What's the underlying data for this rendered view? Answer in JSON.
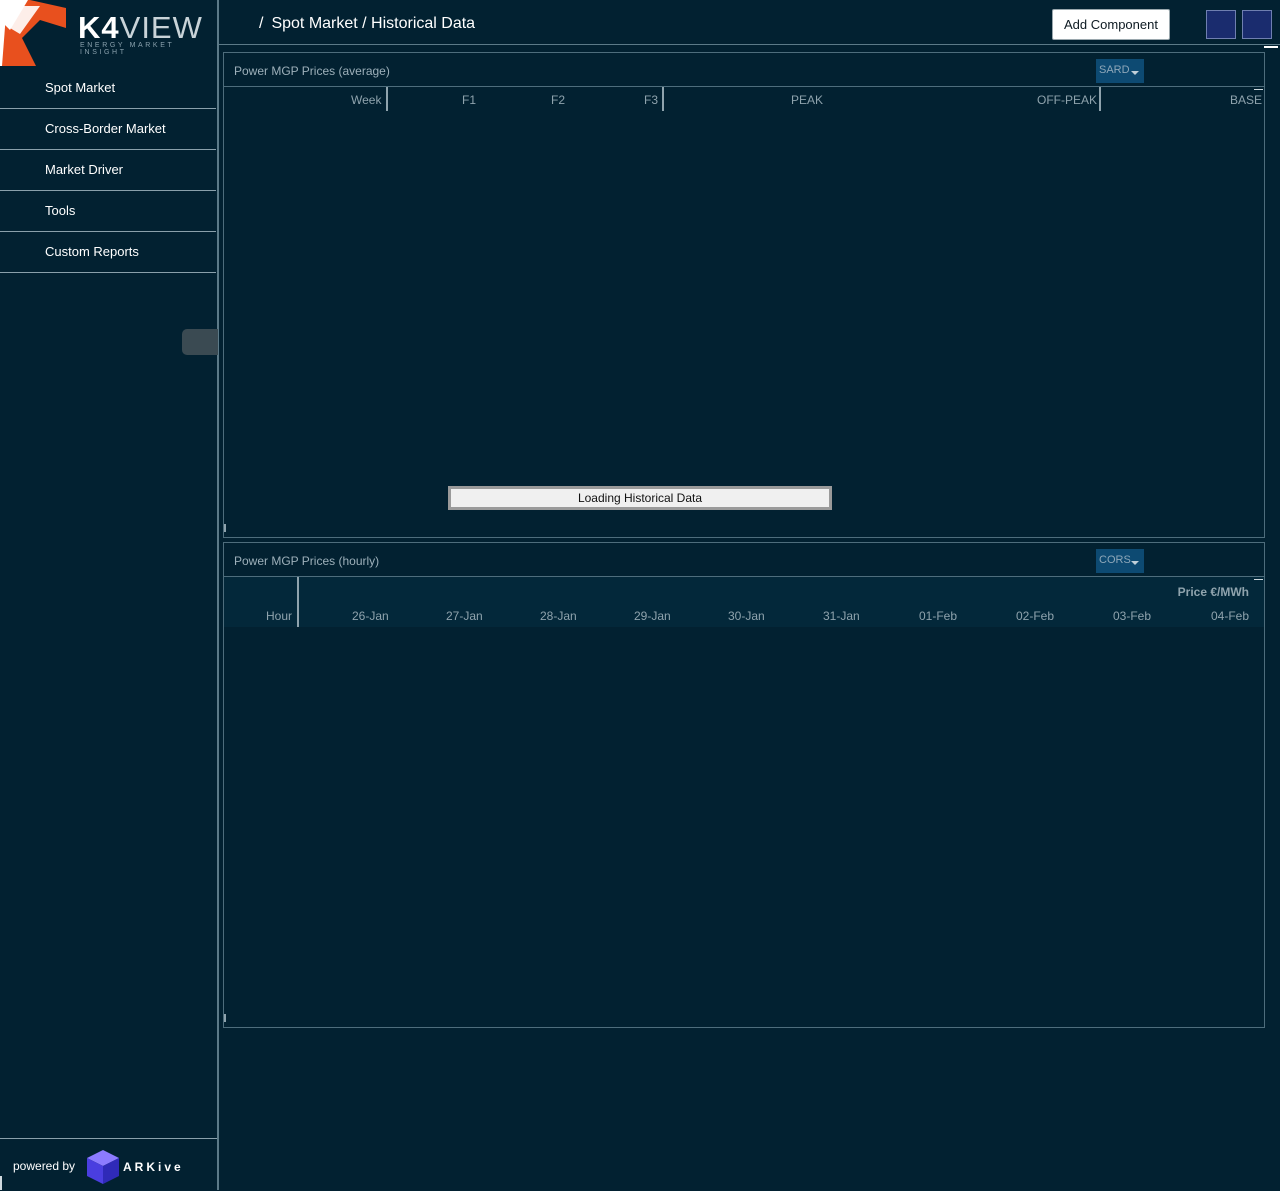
{
  "brand": {
    "logo_text_bold": "K4",
    "logo_text_light": "VIEW",
    "tagline": "ENERGY MARKET INSIGHT",
    "powered_by": "powered by",
    "partner": "ARKive"
  },
  "sidebar": {
    "items": [
      {
        "label": "Spot Market"
      },
      {
        "label": "Cross-Border Market"
      },
      {
        "label": "Market Driver"
      },
      {
        "label": "Tools"
      },
      {
        "label": "Custom Reports"
      }
    ]
  },
  "header": {
    "separator": "/",
    "breadcrumb": "Spot Market / Historical Data",
    "add_component": "Add Component"
  },
  "panel_average": {
    "title": "Power MGP Prices (average)",
    "zone": "SARD",
    "columns": [
      "Week",
      "F1",
      "F2",
      "F3",
      "PEAK",
      "OFF-PEAK",
      "BASE"
    ],
    "loading": "Loading Historical Data"
  },
  "panel_hourly": {
    "title": "Power MGP Prices (hourly)",
    "zone": "CORS",
    "unit": "Price €/MWh",
    "row_header": "Hour",
    "dates": [
      "26-Jan",
      "27-Jan",
      "28-Jan",
      "29-Jan",
      "30-Jan",
      "31-Jan",
      "01-Feb",
      "02-Feb",
      "03-Feb",
      "04-Feb"
    ]
  },
  "colors": {
    "background": "#022131",
    "accent_orange": "#e8501e",
    "dropdown": "#0d4a72",
    "square_button": "#1a2c6e"
  }
}
